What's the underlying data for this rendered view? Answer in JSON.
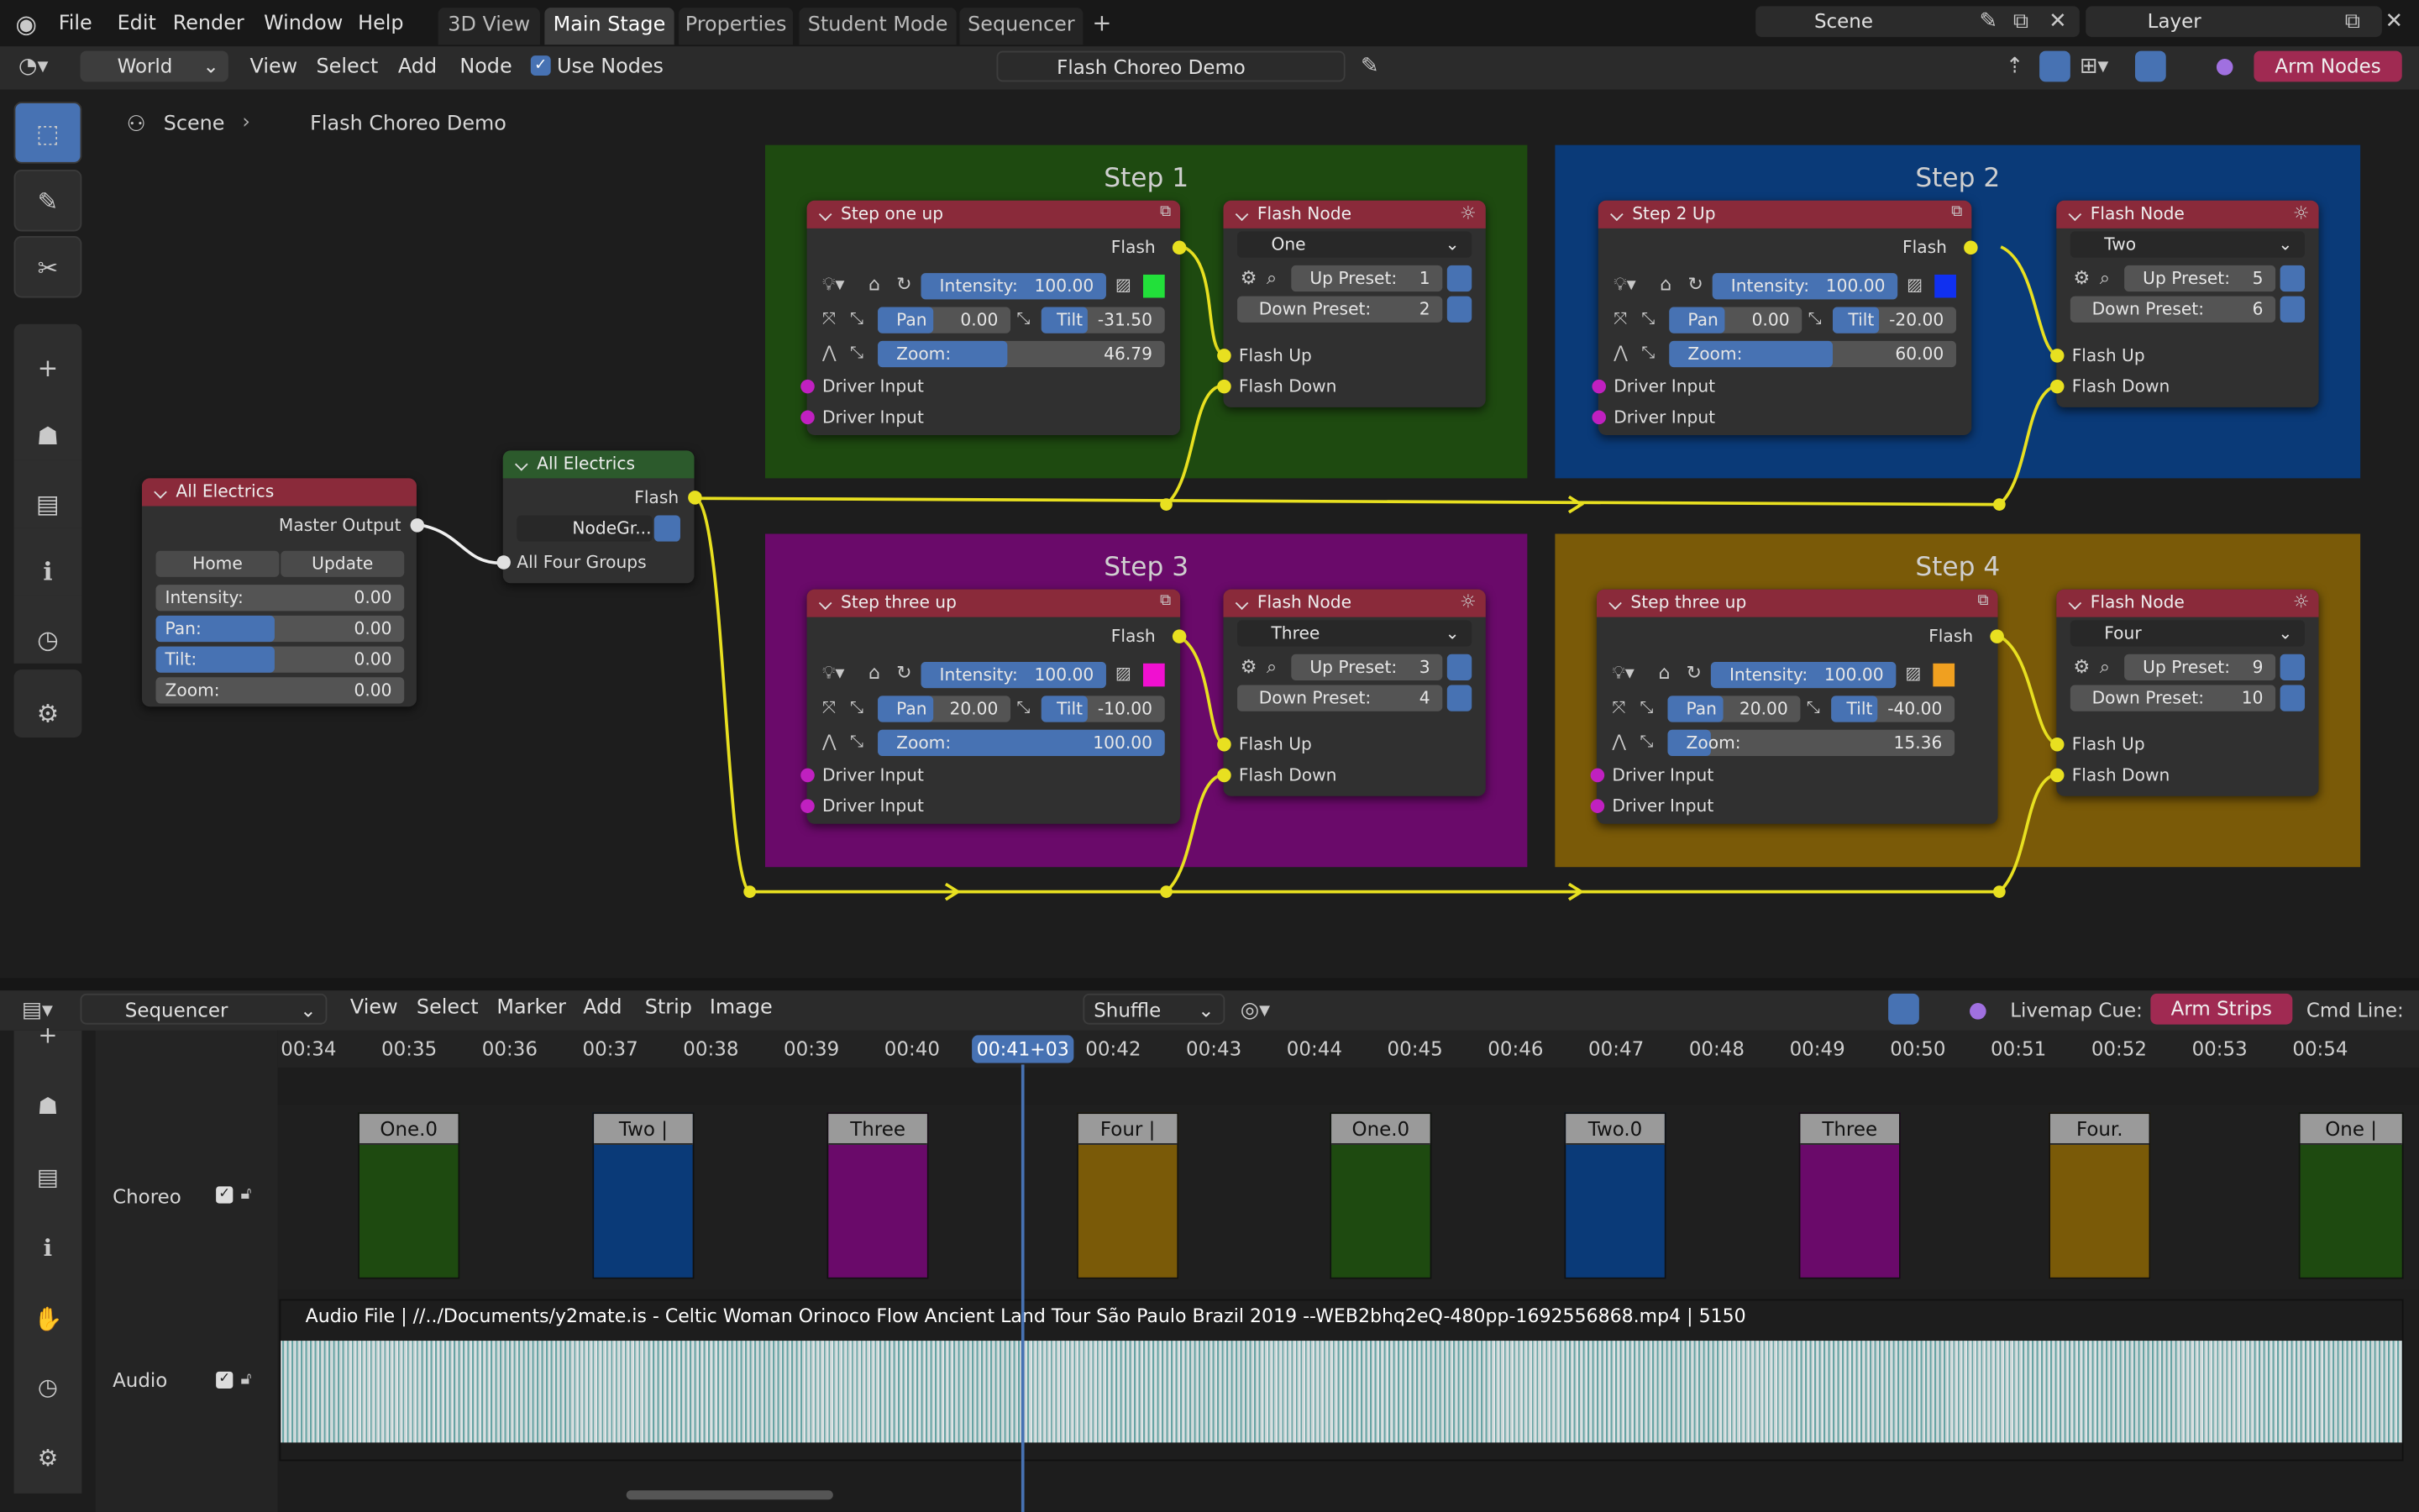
{
  "topbar": {
    "menus": [
      "File",
      "Edit",
      "Render",
      "Window",
      "Help"
    ],
    "workspaces": [
      "3D View",
      "Main Stage",
      "Properties",
      "Student Mode",
      "Sequencer"
    ],
    "active_workspace": "Main Stage",
    "scene": "Scene",
    "layer": "Layer",
    "add_tab": "+"
  },
  "header": {
    "world": "World",
    "menus": [
      "View",
      "Select",
      "Add",
      "Node"
    ],
    "use_nodes": "Use Nodes",
    "datablock": "Flash Choreo Demo",
    "arm_nodes": "Arm Nodes"
  },
  "breadcrumb": {
    "scene": "Scene",
    "tree": "Flash Choreo Demo"
  },
  "frames": [
    {
      "title": "Step 1",
      "color": "#1e4a10"
    },
    {
      "title": "Step 2",
      "color": "#0a3a78"
    },
    {
      "title": "Step 3",
      "color": "#6a0a6a"
    },
    {
      "title": "Step 4",
      "color": "#7a5a08"
    }
  ],
  "electrics": {
    "title": "All Electrics",
    "master_output": "Master Output",
    "home": "Home",
    "update": "Update",
    "intensity_label": "Intensity:",
    "intensity": "0.00",
    "pan_label": "Pan:",
    "pan": "0.00",
    "tilt_label": "Tilt:",
    "tilt": "0.00",
    "zoom_label": "Zoom:",
    "zoom": "0.00"
  },
  "group": {
    "title": "All Electrics",
    "flash": "Flash",
    "nodegroup": "NodeGr...",
    "all_four": "All Four Groups"
  },
  "steps": [
    {
      "title": "Step one up",
      "flash": "Flash",
      "intensity_label": "Intensity:",
      "intensity": "100.00",
      "pan_label": "Pan",
      "pan": "0.00",
      "tilt_label": "Tilt",
      "tilt": "-31.50",
      "zoom_label": "Zoom:",
      "zoom": "46.79",
      "color": "#22e03a",
      "d1": "Driver Input",
      "d2": "Driver Input"
    },
    {
      "title": "Step 2 Up",
      "flash": "Flash",
      "intensity_label": "Intensity:",
      "intensity": "100.00",
      "pan_label": "Pan",
      "pan": "0.00",
      "tilt_label": "Tilt",
      "tilt": "-20.00",
      "zoom_label": "Zoom:",
      "zoom": "60.00",
      "color": "#1030f0",
      "d1": "Driver Input",
      "d2": "Driver Input"
    },
    {
      "title": "Step three up",
      "flash": "Flash",
      "intensity_label": "Intensity:",
      "intensity": "100.00",
      "pan_label": "Pan",
      "pan": "20.00",
      "tilt_label": "Tilt",
      "tilt": "-10.00",
      "zoom_label": "Zoom:",
      "zoom": "100.00",
      "color": "#f010d0",
      "d1": "Driver Input",
      "d2": "Driver Input"
    },
    {
      "title": "Step three up",
      "flash": "Flash",
      "intensity_label": "Intensity:",
      "intensity": "100.00",
      "pan_label": "Pan",
      "pan": "20.00",
      "tilt_label": "Tilt",
      "tilt": "-40.00",
      "zoom_label": "Zoom:",
      "zoom": "15.36",
      "color": "#f0a020",
      "d1": "Driver Input",
      "d2": "Driver Input"
    }
  ],
  "flashnodes": [
    {
      "title": "Flash Node",
      "sel": "One",
      "up_label": "Up Preset:",
      "up": "1",
      "down_label": "Down Preset:",
      "down": "2",
      "fu": "Flash Up",
      "fd": "Flash Down"
    },
    {
      "title": "Flash Node",
      "sel": "Two",
      "up_label": "Up Preset:",
      "up": "5",
      "down_label": "Down Preset:",
      "down": "6",
      "fu": "Flash Up",
      "fd": "Flash Down"
    },
    {
      "title": "Flash Node",
      "sel": "Three",
      "up_label": "Up Preset:",
      "up": "3",
      "down_label": "Down Preset:",
      "down": "4",
      "fu": "Flash Up",
      "fd": "Flash Down"
    },
    {
      "title": "Flash Node",
      "sel": "Four",
      "up_label": "Up Preset:",
      "up": "9",
      "down_label": "Down Preset:",
      "down": "10",
      "fu": "Flash Up",
      "fd": "Flash Down"
    }
  ],
  "seq": {
    "editor": "Sequencer",
    "menus": [
      "View",
      "Select",
      "Marker",
      "Add",
      "Strip",
      "Image"
    ],
    "shuffle": "Shuffle",
    "livemap": "Livemap Cue:",
    "arm_strips": "Arm Strips",
    "cmd": "Cmd Line:"
  },
  "timeline": {
    "ticks": [
      "00:34",
      "00:35",
      "00:36",
      "00:37",
      "00:38",
      "00:39",
      "00:40",
      "00:41+03",
      "00:42",
      "00:43",
      "00:44",
      "00:45",
      "00:46",
      "00:47",
      "00:48",
      "00:49",
      "00:50",
      "00:51",
      "00:52",
      "00:53",
      "00:54"
    ],
    "current": "00:41+03"
  },
  "channels": {
    "choreo": "Choreo",
    "audio": "Audio"
  },
  "clips": [
    {
      "label": "One.0",
      "color": "#1e4a10"
    },
    {
      "label": "Two |",
      "color": "#0a3a78"
    },
    {
      "label": "Three",
      "color": "#6a0a6a"
    },
    {
      "label": "Four |",
      "color": "#7a5a08"
    },
    {
      "label": "One.0",
      "color": "#1e4a10"
    },
    {
      "label": "Two.0",
      "color": "#0a3a78"
    },
    {
      "label": "Three",
      "color": "#6a0a6a"
    },
    {
      "label": "Four.",
      "color": "#7a5a08"
    },
    {
      "label": "One |",
      "color": "#1e4a10"
    }
  ],
  "audio": {
    "label": "Audio File | //../Documents/y2mate.is - Celtic Woman Orinoco Flow Ancient Land Tour São Paulo Brazil 2019 --WEB2bhq2eQ-480pp-1692556868.mp4 | 5150",
    "color": "#3a8a8a"
  }
}
